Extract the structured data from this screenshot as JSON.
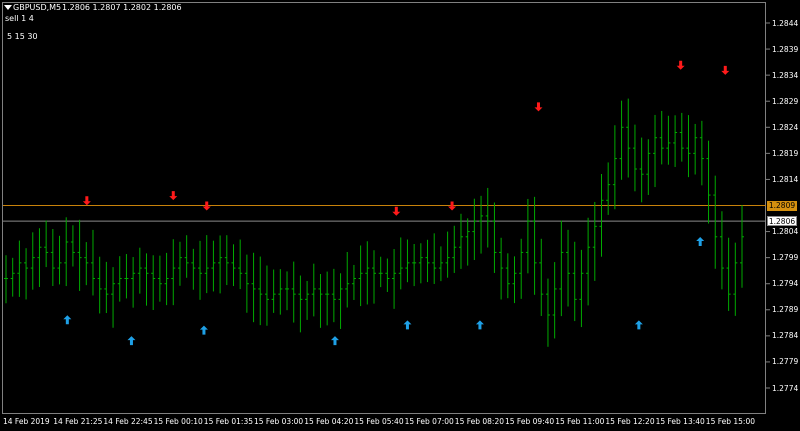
{
  "header": {
    "symbol": "GBPUSD,M5",
    "ohlc": "1.2806 1.2807 1.2802 1.2806",
    "line2": "sell 1 4",
    "line3": "5 15 30"
  },
  "colors": {
    "background": "#000000",
    "candle": "#00aa00",
    "up_arrow": "#1ea0e6",
    "down_arrow": "#ff1a1a",
    "orange_line": "#c8820a",
    "gray_line": "#8a8a8a"
  },
  "price_axis": [
    "1.2844",
    "1.2839",
    "1.2834",
    "1.2829",
    "1.2824",
    "1.2819",
    "1.2814",
    "1.2804",
    "1.2799",
    "1.2794",
    "1.2789",
    "1.2784",
    "1.2779",
    "1.2774"
  ],
  "price_tags": {
    "orange": "1.2809",
    "current": "1.2806"
  },
  "time_axis": [
    "14 Feb 2019",
    "14 Feb 21:25",
    "14 Feb 22:45",
    "15 Feb 00:10",
    "15 Feb 01:35",
    "15 Feb 03:00",
    "15 Feb 04:20",
    "15 Feb 05:40",
    "15 Feb 07:00",
    "15 Feb 08:20",
    "15 Feb 09:40",
    "15 Feb 11:00",
    "15 Feb 12:20",
    "15 Feb 13:40",
    "15 Feb 15:00"
  ],
  "chart_data": {
    "type": "ohlc",
    "ylim": [
      1.277,
      1.2848
    ],
    "series": [
      {
        "values": [
          1.2795,
          1.2796,
          1.2798,
          1.2797,
          1.2799,
          1.2801,
          1.28,
          1.2797,
          1.2798,
          1.2802,
          1.28,
          1.2799,
          1.2798,
          1.2795,
          1.2793,
          1.2792,
          1.2794,
          1.2795,
          1.2795,
          1.2796,
          1.2797,
          1.2796,
          1.2795,
          1.2794,
          1.2795,
          1.2797,
          1.2799,
          1.2798,
          1.2797,
          1.2796,
          1.2797,
          1.2798,
          1.2799,
          1.2798,
          1.2797,
          1.2796,
          1.2794,
          1.2793,
          1.2792,
          1.2791,
          1.2792,
          1.2793,
          1.2793,
          1.2792,
          1.2791,
          1.2792,
          1.2793,
          1.2792,
          1.2792,
          1.2791,
          1.2793,
          1.2794,
          1.2795,
          1.2796,
          1.2797,
          1.2796,
          1.2796,
          1.2795,
          1.2796,
          1.2797,
          1.2798,
          1.2798,
          1.2799,
          1.2798,
          1.2797,
          1.2798,
          1.2799,
          1.2801,
          1.2803,
          1.2804,
          1.2806,
          1.2807,
          1.2806,
          1.28,
          1.2797,
          1.2794,
          1.2796,
          1.28,
          1.2806,
          1.2798,
          1.2792,
          1.2788,
          1.2793,
          1.28,
          1.2796,
          1.2791,
          1.2796,
          1.2801,
          1.2805,
          1.281,
          1.2813,
          1.2818,
          1.2824,
          1.282,
          1.2816,
          1.2815,
          1.2819,
          1.2822,
          1.282,
          1.2821,
          1.2823,
          1.282,
          1.2819,
          1.2822,
          1.2818,
          1.2811,
          1.2803,
          1.2797,
          1.2792,
          1.2798,
          1.2803
        ]
      }
    ]
  },
  "up_arrows": [
    {
      "x": 22,
      "price": 1.2787
    },
    {
      "x": 45,
      "price": 1.2783
    },
    {
      "x": 71,
      "price": 1.2785
    },
    {
      "x": 118,
      "price": 1.2783
    },
    {
      "x": 144,
      "price": 1.2786
    },
    {
      "x": 170,
      "price": 1.2786
    },
    {
      "x": 227,
      "price": 1.2786
    },
    {
      "x": 249,
      "price": 1.2802
    }
  ],
  "down_arrows": [
    {
      "x": 29,
      "price": 1.281
    },
    {
      "x": 60,
      "price": 1.2811
    },
    {
      "x": 72,
      "price": 1.2809
    },
    {
      "x": 140,
      "price": 1.2808
    },
    {
      "x": 160,
      "price": 1.2809
    },
    {
      "x": 191,
      "price": 1.2828
    },
    {
      "x": 242,
      "price": 1.2836
    },
    {
      "x": 258,
      "price": 1.2835
    }
  ]
}
